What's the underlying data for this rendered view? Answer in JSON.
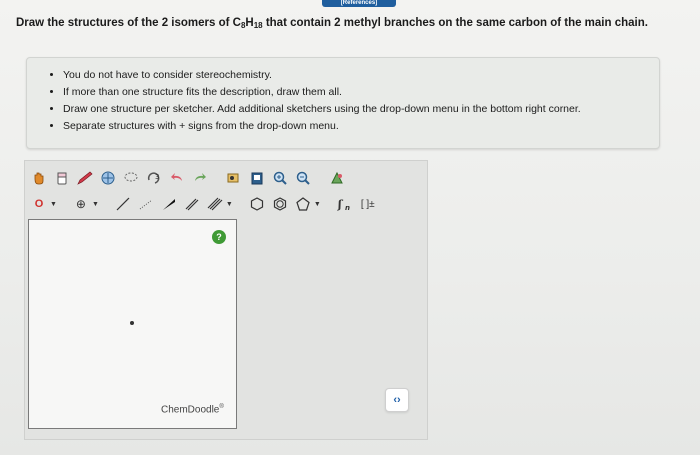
{
  "header": {
    "tab_label": "[References]"
  },
  "question": {
    "prefix": "Draw the structures of the 2 isomers of C",
    "c_sub": "8",
    "h": "H",
    "h_sub": "18",
    "suffix": " that contain 2 methyl branches on the same carbon of the main chain."
  },
  "instructions": {
    "items": [
      "You do not have to consider stereochemistry.",
      "If more than one structure fits the description, draw them all.",
      "Draw one structure per sketcher. Add additional sketchers using the drop-down menu in the bottom right corner.",
      "Separate structures with + signs from the drop-down menu."
    ]
  },
  "sketcher": {
    "row1_icons": [
      "hand-icon",
      "eraser-icon",
      "pencil-icon",
      "ring-template-icon",
      "lasso-icon",
      "rotate-icon",
      "undo-icon",
      "redo-icon",
      "copy-icon",
      "paste-icon",
      "zoom-in-icon",
      "zoom-out-icon",
      "clean-icon"
    ],
    "row2_atom_label": "O",
    "charge_label": "⊕",
    "bracket_label": "[ ]±",
    "help_label": "?",
    "brand_label": "ChemDoodle",
    "brand_mark": "®"
  },
  "nav": {
    "toggle_label": "‹›"
  },
  "colors": {
    "accent": "#1f5e9e",
    "help": "#3f9a35",
    "atom_o": "#d0312d"
  }
}
